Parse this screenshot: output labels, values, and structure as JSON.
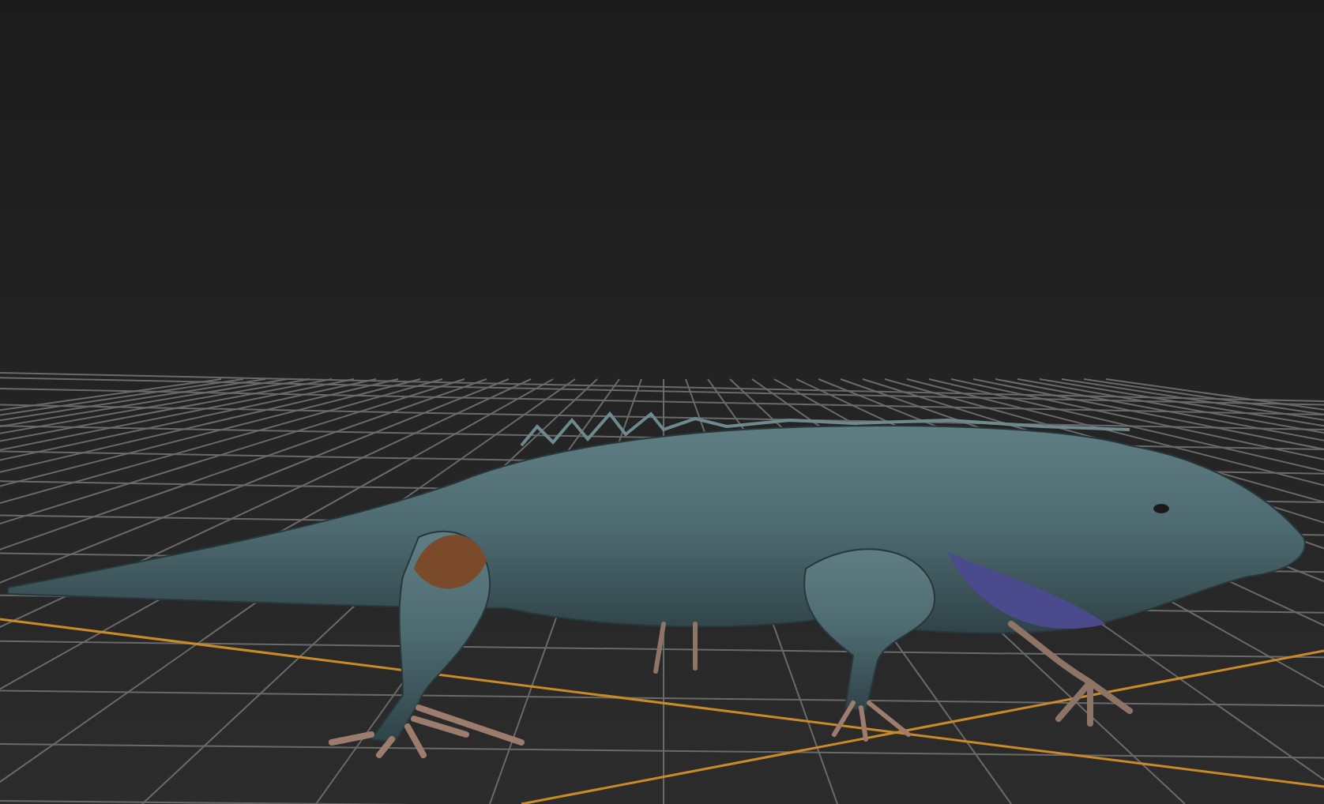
{
  "viewport": {
    "grid_visible": true,
    "model": {
      "kind": "lizard"
    }
  }
}
